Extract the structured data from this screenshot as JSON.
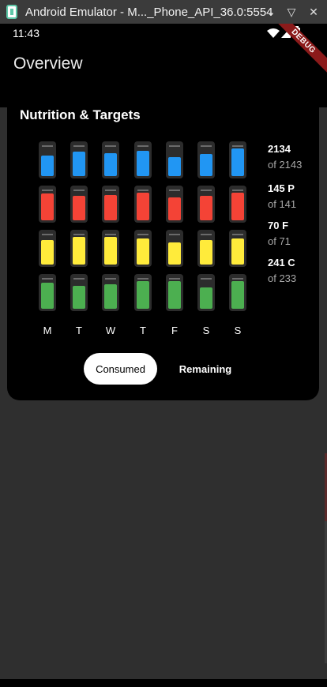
{
  "window": {
    "title": "Android Emulator - M..._Phone_API_36.0:5554",
    "controls": {
      "minimize": "⌄",
      "restore": "▽",
      "close": "✕"
    }
  },
  "status_bar": {
    "time": "11:43",
    "icons": [
      "wifi-icon",
      "signal-icon",
      "battery-icon"
    ]
  },
  "app_bar": {
    "title": "Overview",
    "debug_banner": "DEBUG"
  },
  "card": {
    "title": "Nutrition & Targets",
    "days": [
      "M",
      "T",
      "W",
      "T",
      "F",
      "S",
      "S"
    ],
    "colors": {
      "calories": "#2196f3",
      "protein": "#f44336",
      "fat": "#ffeb3b",
      "carbs": "#4caf50",
      "track": "#2c2c2c"
    },
    "rows": [
      {
        "key": "calories",
        "fill_fraction": [
          0.72,
          0.85,
          0.8,
          0.88,
          0.68,
          0.78,
          0.96
        ]
      },
      {
        "key": "protein",
        "fill_fraction": [
          0.95,
          0.85,
          0.9,
          0.97,
          0.8,
          0.85,
          0.97
        ]
      },
      {
        "key": "fat",
        "fill_fraction": [
          0.85,
          0.97,
          0.97,
          0.92,
          0.77,
          0.85,
          0.92
        ]
      },
      {
        "key": "carbs",
        "fill_fraction": [
          0.93,
          0.8,
          0.85,
          0.97,
          0.97,
          0.75,
          0.97
        ]
      }
    ],
    "stats": [
      {
        "value": "2134",
        "target": "of 2143"
      },
      {
        "value": "145 P",
        "target": "of 141"
      },
      {
        "value": "70 F",
        "target": "of 71"
      },
      {
        "value": "241 C",
        "target": "of 233"
      }
    ],
    "toggle": {
      "consumed": "Consumed",
      "remaining": "Remaining",
      "selected": "Consumed"
    }
  }
}
